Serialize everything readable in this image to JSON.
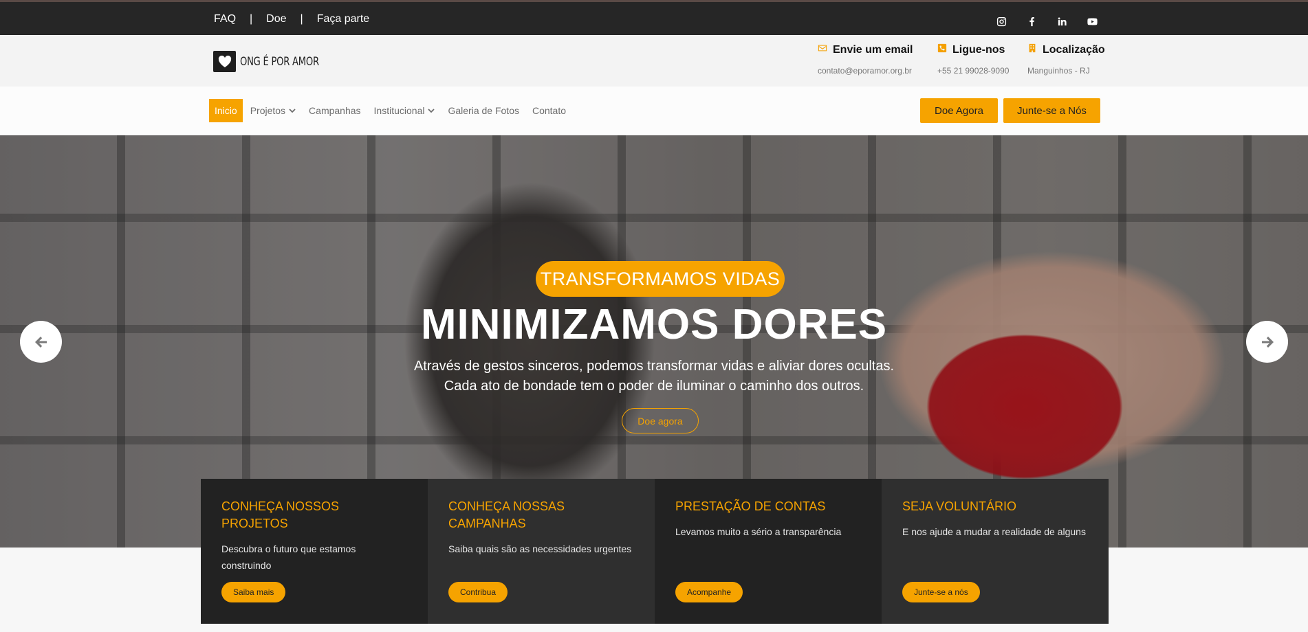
{
  "topbar": {
    "links": [
      "FAQ",
      "Doe",
      "Faça parte"
    ],
    "separator": "|",
    "social_icons": [
      "instagram-icon",
      "facebook-icon",
      "linkedin-icon",
      "youtube-icon"
    ]
  },
  "header": {
    "logo_text": "ONG É POR AMOR",
    "logo_icon": "heart-icon",
    "contacts": [
      {
        "icon": "envelope-icon",
        "title": "Envie um email",
        "value": "contato@eporamor.org.br"
      },
      {
        "icon": "phone-icon",
        "title": "Ligue-nos",
        "value": "+55 21 99028-9090"
      },
      {
        "icon": "building-icon",
        "title": "Localização",
        "value": "Manguinhos - RJ"
      }
    ]
  },
  "nav": {
    "items": [
      {
        "label": "Inicio",
        "active": true,
        "dropdown": false
      },
      {
        "label": "Projetos",
        "active": false,
        "dropdown": true
      },
      {
        "label": "Campanhas",
        "active": false,
        "dropdown": false
      },
      {
        "label": "Institucional",
        "active": false,
        "dropdown": true
      },
      {
        "label": "Galeria de Fotos",
        "active": false,
        "dropdown": false
      },
      {
        "label": "Contato",
        "active": false,
        "dropdown": false
      }
    ],
    "donate_label": "Doe Agora",
    "join_label": "Junte-se a Nós"
  },
  "hero": {
    "pill": "TRANSFORMAMOS VIDAS",
    "title": "MINIMIZAMOS DORES",
    "desc_line1": "Através de gestos sinceros, podemos transformar vidas e aliviar dores ocultas.",
    "desc_line2": "Cada ato de bondade tem o poder de iluminar o caminho dos outros.",
    "button": "Doe agora"
  },
  "cards": [
    {
      "title": "CONHEÇA NOSSOS PROJETOS",
      "text": "Descubra o futuro que estamos construindo",
      "button": "Saiba mais"
    },
    {
      "title": "CONHEÇA NOSSAS CAMPANHAS",
      "text": "Saiba quais são as necessidades urgentes",
      "button": "Contribua"
    },
    {
      "title": "PRESTAÇÃO DE CONTAS",
      "text": "Levamos muito a sério a transparência",
      "button": "Acompanhe"
    },
    {
      "title": "SEJA VOLUNTÁRIO",
      "text": "E nos ajude a mudar a realidade de alguns",
      "button": "Junte-se a nós"
    }
  ],
  "colors": {
    "accent": "#f6a300",
    "topbar": "#262626",
    "card_dark": "#222222",
    "card_mid": "#2f2f2f"
  }
}
